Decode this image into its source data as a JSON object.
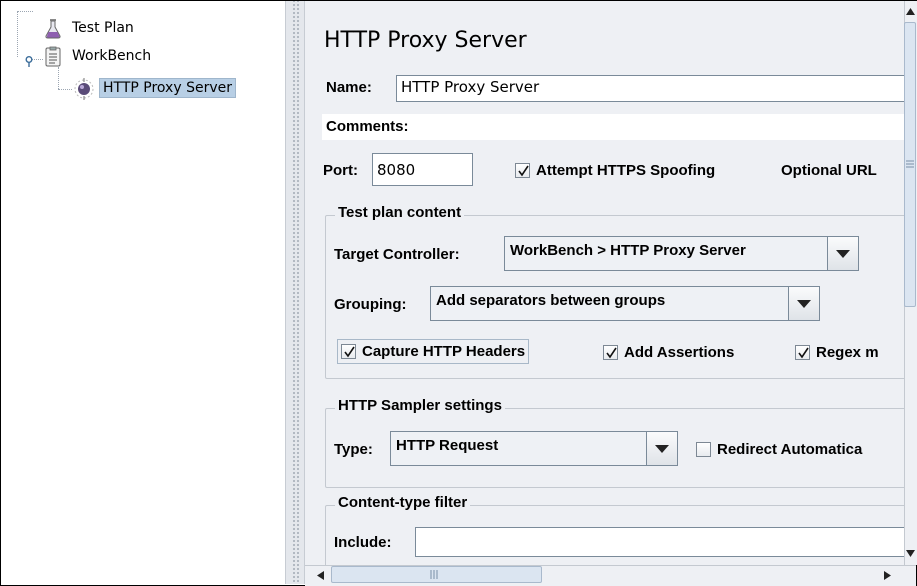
{
  "tree": {
    "nodes": [
      {
        "label": "Test Plan",
        "icon": "flask-icon"
      },
      {
        "label": "WorkBench",
        "icon": "clipboard-icon"
      },
      {
        "label": "HTTP Proxy Server",
        "icon": "proxy-globe-icon",
        "selected": true
      }
    ]
  },
  "panel": {
    "title": "HTTP Proxy Server",
    "name_label": "Name:",
    "name_value": "HTTP Proxy Server",
    "comments_label": "Comments:",
    "comments_value": "",
    "port_label": "Port:",
    "port_value": "8080",
    "https_spoofing": {
      "label": "Attempt HTTPS Spoofing",
      "checked": true
    },
    "optional_url_label": "Optional URL"
  },
  "test_plan_content": {
    "title": "Test plan content",
    "target_controller_label": "Target Controller:",
    "target_controller_value": "WorkBench > HTTP Proxy Server",
    "grouping_label": "Grouping:",
    "grouping_value": "Add separators between groups",
    "capture_headers": {
      "label": "Capture HTTP Headers",
      "checked": true
    },
    "add_assertions": {
      "label": "Add Assertions",
      "checked": true
    },
    "regex_matching": {
      "label": "Regex m",
      "checked": true
    }
  },
  "http_sampler_settings": {
    "title": "HTTP Sampler settings",
    "type_label": "Type:",
    "type_value": "HTTP Request",
    "redirect": {
      "label": "Redirect Automatica",
      "checked": false
    }
  },
  "content_type_filter": {
    "title": "Content-type filter",
    "include_label": "Include:",
    "include_value": ""
  },
  "colors": {
    "selection": "#b8cfe5",
    "panel_bg": "#eef0f4",
    "scroll_thumb": "#dbe5f1"
  }
}
